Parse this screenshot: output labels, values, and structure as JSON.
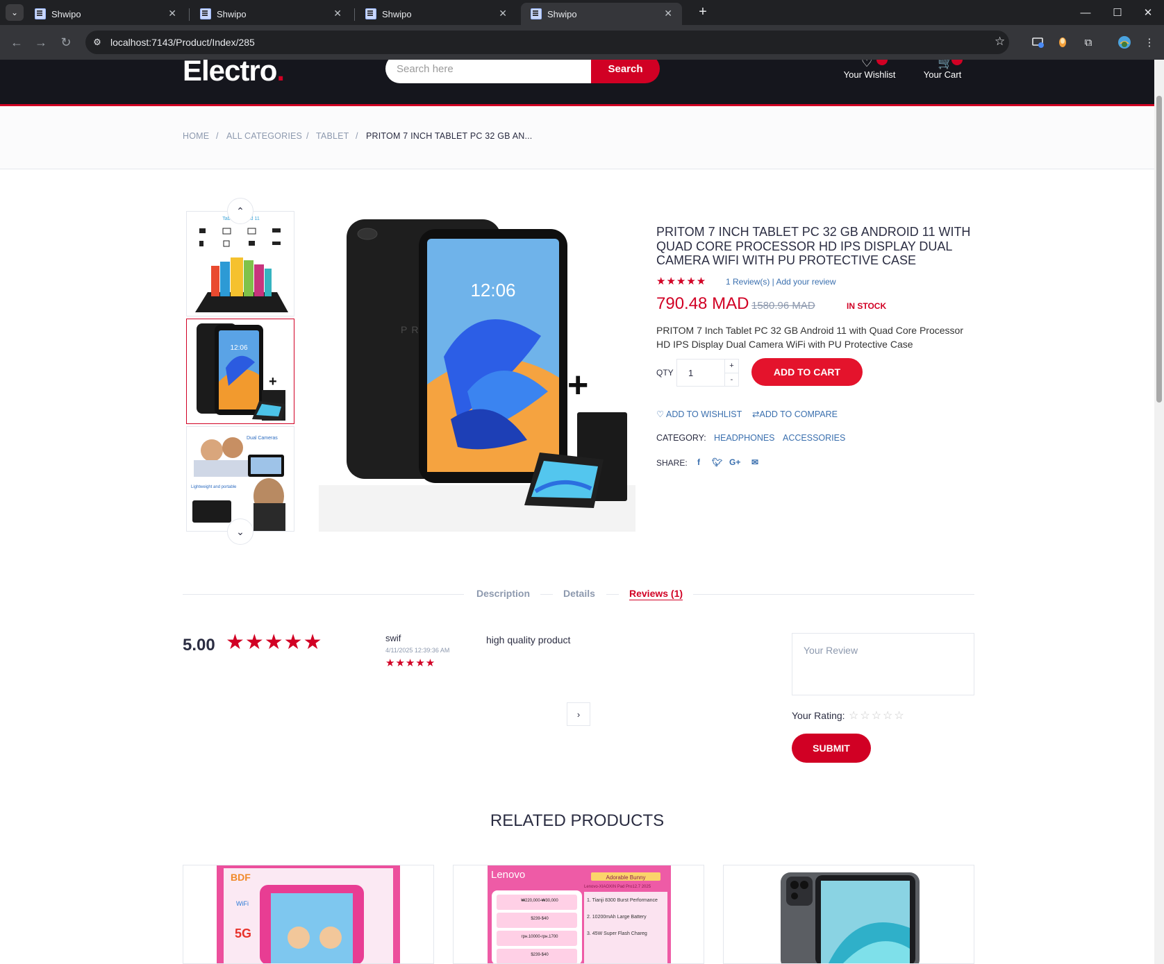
{
  "browser": {
    "tabs": [
      {
        "title": "Shwipo"
      },
      {
        "title": "Shwipo"
      },
      {
        "title": "Shwipo"
      },
      {
        "title": "Shwipo"
      }
    ],
    "url": "localhost:7143/Product/Index/285"
  },
  "header": {
    "logo": "Electro",
    "logo_dot": ".",
    "search_placeholder": "Search here",
    "search_button": "Search",
    "wishlist_label": "Your Wishlist",
    "cart_label": "Your Cart"
  },
  "breadcrumb": {
    "items": [
      "HOME",
      "ALL CATEGORIES",
      "TABLET",
      "PRITOM 7 INCH TABLET PC 32 GB AN..."
    ],
    "separator": "/"
  },
  "product": {
    "title": "PRITOM 7 INCH TABLET PC 32 GB ANDROID 11 WITH QUAD CORE PROCESSOR HD IPS DISPLAY DUAL CAMERA WIFI WITH PU PROTECTIVE CASE",
    "rating_stars": 5,
    "review_link": "1 Review(s) | Add your review",
    "price": "790.48 MAD",
    "old_price": "1580.96 MAD",
    "stock": "IN STOCK",
    "description": "PRITOM 7 Inch Tablet PC 32 GB Android 11 with Quad Core Processor HD IPS Display Dual Camera WiFi with PU Protective Case",
    "qty_label": "QTY",
    "qty_value": "1",
    "qty_plus": "+",
    "qty_minus": "-",
    "add_to_cart": "ADD TO CART",
    "add_to_wishlist": "ADD TO WISHLIST",
    "add_to_compare": "ADD TO COMPARE",
    "category_label": "CATEGORY:",
    "categories": [
      "HEADPHONES",
      "ACCESSORIES"
    ],
    "share_label": "SHARE:",
    "screen_time": "12:06",
    "thumb1_caption": "Tablet Android 11",
    "thumb3_caption_a": "Dual Cameras",
    "thumb3_caption_b": "Lightweight and portable"
  },
  "tabs": {
    "items": [
      "Description",
      "Details",
      "Reviews (1)"
    ],
    "active": "Reviews (1)"
  },
  "reviews": {
    "average": "5.00",
    "list": [
      {
        "name": "swif",
        "date": "4/11/2025 12:39:36 AM",
        "stars": 5,
        "text": "high quality product"
      }
    ],
    "form": {
      "placeholder": "Your Review",
      "rating_label": "Your Rating:",
      "submit": "SUBMIT"
    }
  },
  "related": {
    "title": "RELATED PRODUCTS",
    "card1_brand": "BDF",
    "card1_badges": [
      "WiFi",
      "5G"
    ],
    "card2_brand": "Lenovo",
    "card2_tag": "Adorable Bunny",
    "card2_subtitle": "Lenovo-XIAOXIN Pad Pro12.7 2025",
    "card2_features": [
      "1. Tianji 8300 Burst Performance",
      "2. 10200mAh Large Battery",
      "3. 45W Super Flash Chareg"
    ],
    "card2_prices": [
      "₩220,000-₩30,000",
      "$239-$40",
      "грн.10000-грн.1700",
      "$239-$40"
    ]
  },
  "colors": {
    "brand_red": "#d10024",
    "header_dark": "#15161d",
    "link_blue": "#3a6fae"
  }
}
